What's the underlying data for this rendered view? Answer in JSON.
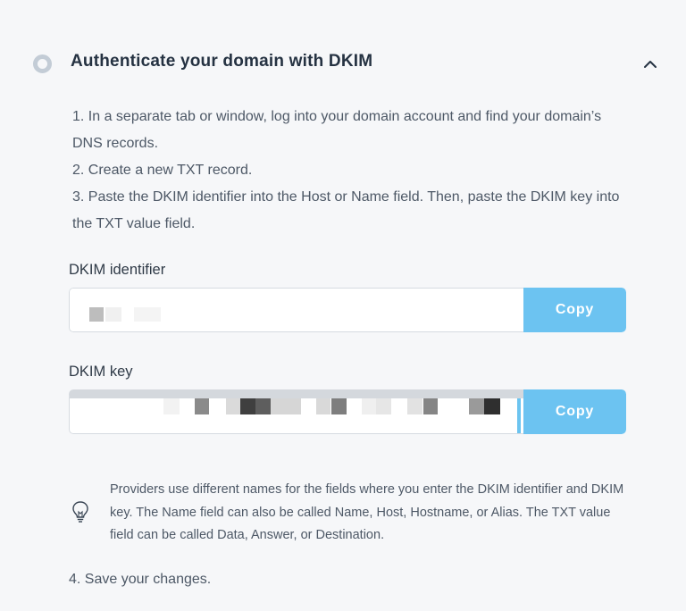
{
  "section": {
    "title": "Authenticate your domain with DKIM",
    "steps": [
      "1. In a separate tab or window, log into your domain account and find your domain’s DNS records.",
      "2. Create a new TXT record.",
      "3. Paste the DKIM identifier into the Host or Name field. Then, paste the DKIM key into the TXT value field."
    ],
    "final_step": "4. Save your changes."
  },
  "dkim_identifier": {
    "label": "DKIM identifier",
    "copy_label": "Copy"
  },
  "dkim_key": {
    "label": "DKIM key",
    "copy_label": "Copy"
  },
  "tip": {
    "icon": "lightbulb-icon",
    "text": "Providers use different names for the fields where you enter the DKIM identifier and DKIM key. The Name field can also be called Name, Host, Hostname, or Alias. The TXT value field can be called Data, Answer, or Destination."
  },
  "colors": {
    "accent": "#6cc3f1",
    "status_ring": "#c3ccd6",
    "background": "#f6f7f9"
  }
}
